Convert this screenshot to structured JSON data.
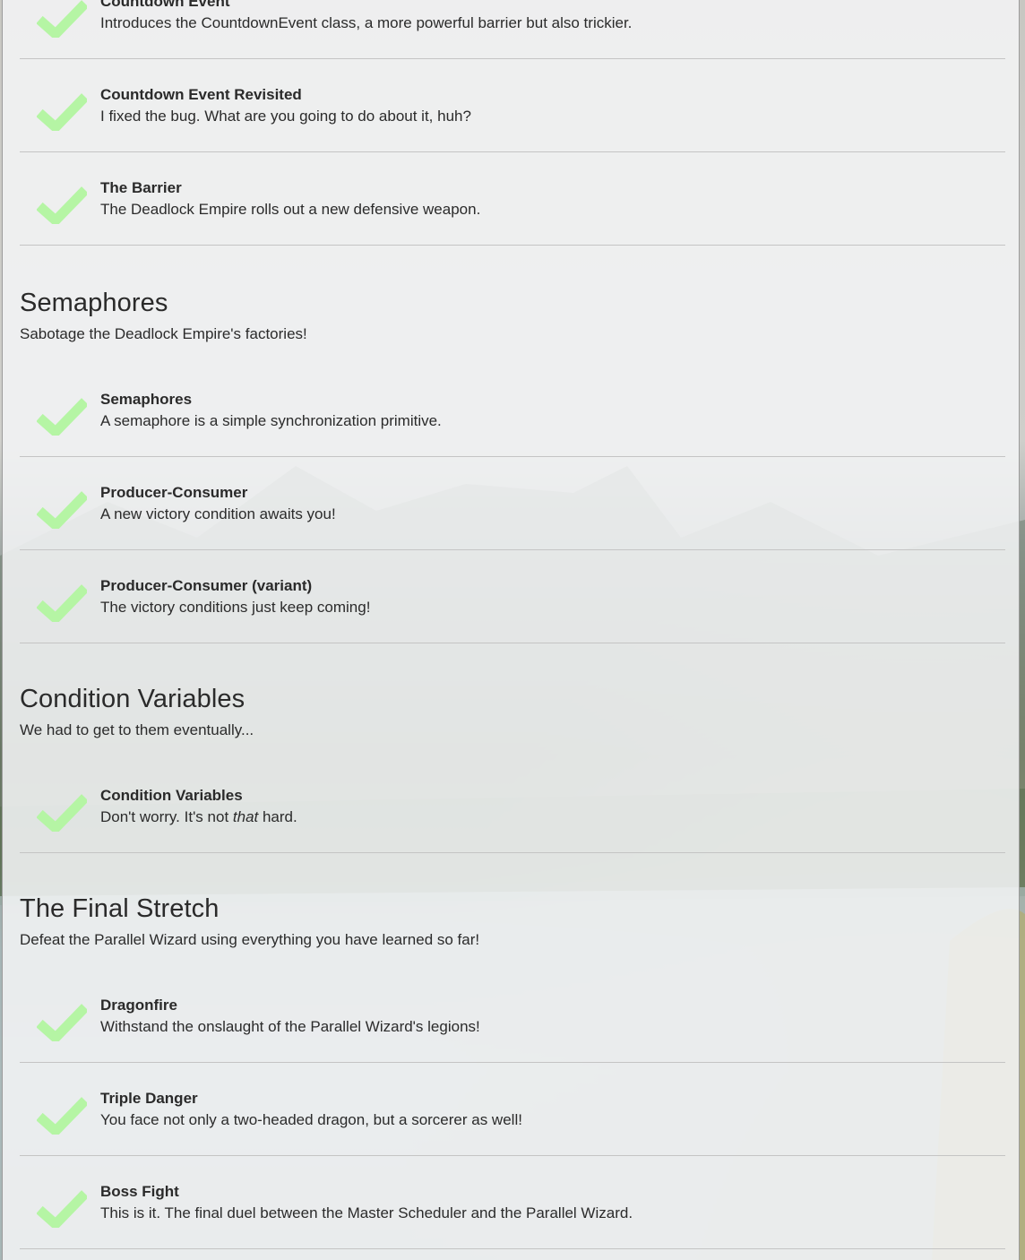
{
  "colors": {
    "check": "#b5f5a4",
    "divider": "#c4c4c4",
    "panel": "#f3f4f5"
  },
  "top_levels": [
    {
      "name": "Countdown Event",
      "desc": "Introduces the CountdownEvent class, a more powerful barrier but also trickier."
    },
    {
      "name": "Countdown Event Revisited",
      "desc": "I fixed the bug. What are you going to do about it, huh?"
    },
    {
      "name": "The Barrier",
      "desc": "The Deadlock Empire rolls out a new defensive weapon."
    }
  ],
  "sections": [
    {
      "title": "Semaphores",
      "desc": "Sabotage the Deadlock Empire's factories!",
      "levels": [
        {
          "name": "Semaphores",
          "desc": "A semaphore is a simple synchronization primitive."
        },
        {
          "name": "Producer-Consumer",
          "desc": "A new victory condition awaits you!"
        },
        {
          "name": "Producer-Consumer (variant)",
          "desc": "The victory conditions just keep coming!"
        }
      ]
    },
    {
      "title": "Condition Variables",
      "desc": "We had to get to them eventually...",
      "levels": [
        {
          "name": "Condition Variables",
          "desc_prefix": "Don't worry. It's not ",
          "desc_em": "that",
          "desc_suffix": " hard."
        }
      ]
    },
    {
      "title": "The Final Stretch",
      "desc": "Defeat the Parallel Wizard using everything you have learned so far!",
      "levels": [
        {
          "name": "Dragonfire",
          "desc": "Withstand the onslaught of the Parallel Wizard's legions!"
        },
        {
          "name": "Triple Danger",
          "desc": "You face not only a two-headed dragon, but a sorcerer as well!"
        },
        {
          "name": "Boss Fight",
          "desc": "This is it. The final duel between the Master Scheduler and the Parallel Wizard."
        }
      ]
    }
  ]
}
